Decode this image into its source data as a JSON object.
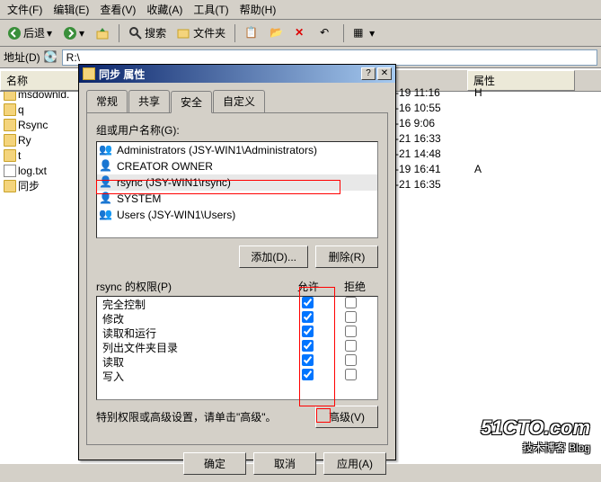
{
  "menubar": {
    "file": "文件(F)",
    "edit": "编辑(E)",
    "view": "查看(V)",
    "favorites": "收藏(A)",
    "tools": "工具(T)",
    "help": "帮助(H)"
  },
  "toolbar": {
    "back": "后退",
    "search": "搜索",
    "folders": "文件夹"
  },
  "addressbar": {
    "label": "地址(D)",
    "value": "R:\\"
  },
  "columns": {
    "name": "名称",
    "attr": "属性"
  },
  "files": [
    {
      "name": "msdownld.",
      "date": "-19 11:16",
      "attr": "H"
    },
    {
      "name": "q",
      "date": "-16 10:55",
      "attr": ""
    },
    {
      "name": "Rsync",
      "date": "-16 9:06",
      "attr": ""
    },
    {
      "name": "Ry",
      "date": "-21 16:33",
      "attr": ""
    },
    {
      "name": "t",
      "date": "-21 14:48",
      "attr": ""
    },
    {
      "name": "log.txt",
      "date": "-19 16:41",
      "attr": "A"
    },
    {
      "name": "同步",
      "date": "-21 16:35",
      "attr": ""
    }
  ],
  "dialog": {
    "title": "同步 属性",
    "tabs": {
      "general": "常规",
      "share": "共享",
      "security": "安全",
      "custom": "自定义"
    },
    "groups_label": "组或用户名称(G):",
    "groups": [
      "Administrators (JSY-WIN1\\Administrators)",
      "CREATOR OWNER",
      "rsync (JSY-WIN1\\rsync)",
      "SYSTEM",
      "Users (JSY-WIN1\\Users)"
    ],
    "add_btn": "添加(D)...",
    "remove_btn": "删除(R)",
    "perm_for": "rsync 的权限(P)",
    "allow": "允许",
    "deny": "拒绝",
    "perms": [
      {
        "name": "完全控制",
        "allow": true,
        "deny": false
      },
      {
        "name": "修改",
        "allow": true,
        "deny": false
      },
      {
        "name": "读取和运行",
        "allow": true,
        "deny": false
      },
      {
        "name": "列出文件夹目录",
        "allow": true,
        "deny": false
      },
      {
        "name": "读取",
        "allow": true,
        "deny": false
      },
      {
        "name": "写入",
        "allow": true,
        "deny": false
      }
    ],
    "special_text": "特别权限或高级设置，请单击\"高级\"。",
    "advanced_btn": "高级(V)",
    "ok": "确定",
    "cancel": "取消",
    "apply": "应用(A)"
  },
  "watermark": {
    "line1": "51CTO.com",
    "line2": "技术博客  Blog"
  }
}
